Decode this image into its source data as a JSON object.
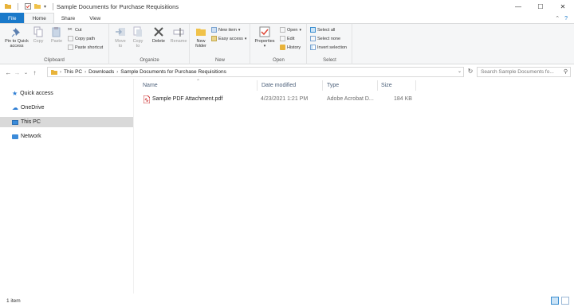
{
  "window": {
    "title": "Sample Documents for Purchase Requisitions",
    "minimize": "—",
    "maximize": "☐",
    "close": "✕"
  },
  "tabs": [
    "File",
    "Home",
    "Share",
    "View"
  ],
  "ribbon": {
    "clipboard": {
      "label": "Clipboard",
      "pin": "Pin to Quick access",
      "copy": "Copy",
      "paste": "Paste",
      "cut": "Cut",
      "copy_path": "Copy path",
      "paste_shortcut": "Paste shortcut"
    },
    "organize": {
      "label": "Organize",
      "move_to": "Move to",
      "copy_to": "Copy to",
      "delete": "Delete",
      "rename": "Rename"
    },
    "new": {
      "label": "New",
      "new_folder": "New folder",
      "new_item": "New item",
      "easy_access": "Easy access"
    },
    "open": {
      "label": "Open",
      "properties": "Properties",
      "open": "Open",
      "edit": "Edit",
      "history": "History"
    },
    "select": {
      "label": "Select",
      "select_all": "Select all",
      "select_none": "Select none",
      "invert_selection": "Invert selection"
    }
  },
  "address": {
    "crumbs": [
      "This PC",
      "Downloads",
      "Sample Documents for Purchase Requisitions"
    ],
    "search_placeholder": "Search Sample Documents fo..."
  },
  "nav": {
    "items": [
      "Quick access",
      "OneDrive",
      "This PC",
      "Network"
    ]
  },
  "columns": [
    "Name",
    "Date modified",
    "Type",
    "Size"
  ],
  "files": [
    {
      "name": "Sample PDF Attachment.pdf",
      "date_modified": "4/23/2021 1:21 PM",
      "type": "Adobe Acrobat D...",
      "size": "184 KB"
    }
  ],
  "status": {
    "item_count": "1 item"
  },
  "colors": {
    "file_tab": "#1979ca",
    "ribbon_bg": "#f5f6f7",
    "selected_nav": "#d9d9d9",
    "column_header_text": "#4c607a"
  }
}
